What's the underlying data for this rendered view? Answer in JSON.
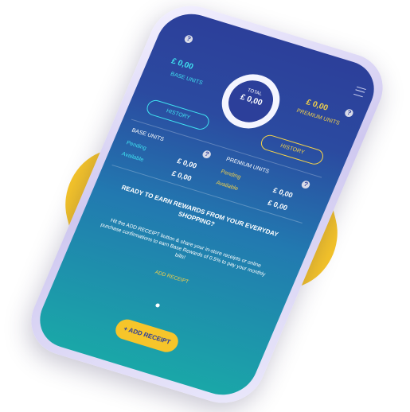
{
  "header": {
    "base_amount": "£ 0,00",
    "base_label": "BASE UNITS",
    "total_label": "TOTAL",
    "total_amount": "£ 0,00",
    "premium_amount": "£ 0,00",
    "premium_label": "PREMIUM UNITS",
    "history_left": "HISTORY",
    "history_right": "HISTORY"
  },
  "base_card": {
    "title": "BASE UNITS",
    "pending_label": "Pending",
    "pending_value": "£ 0,00",
    "available_label": "Available",
    "available_value": "£ 0,00"
  },
  "premium_card": {
    "title": "PREMIUM UNITS",
    "pending_label": "Pending",
    "pending_value": "£ 0,00",
    "available_label": "Available",
    "available_value": "£ 0,00"
  },
  "promo": {
    "headline": "READY TO EARN REWARDS FROM YOUR EVERYDAY SHOPPING?",
    "body": "Hit the ADD RECEIPT button & share your in-store receipts or online purchase confirmations to earn Base Rewards of 0.5% to pay your monthly bills!",
    "link": "ADD RECEIPT"
  },
  "cta": {
    "label": "+ ADD RECEIPT"
  },
  "icons": {
    "help": "?",
    "menu": "menu-icon"
  }
}
